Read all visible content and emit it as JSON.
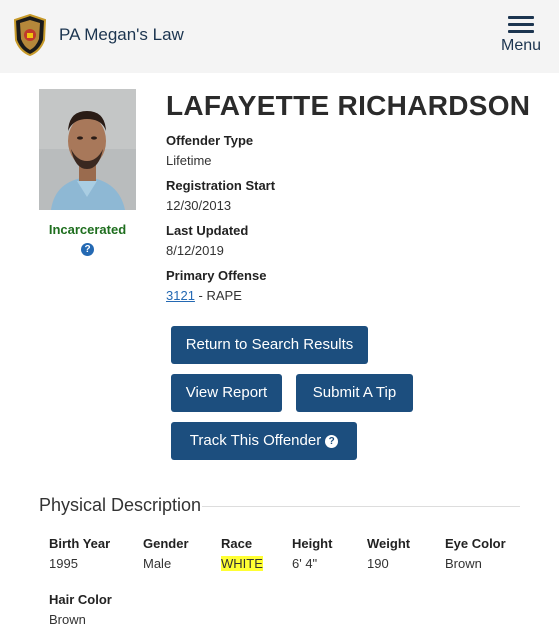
{
  "header": {
    "site_title": "PA Megan's Law",
    "menu_label": "Menu"
  },
  "offender": {
    "name": "LAFAYETTE RICHARDSON",
    "status": "Incarcerated",
    "fields": {
      "offender_type_label": "Offender Type",
      "offender_type": "Lifetime",
      "registration_start_label": "Registration Start",
      "registration_start": "12/30/2013",
      "last_updated_label": "Last Updated",
      "last_updated": "8/12/2019",
      "primary_offense_label": "Primary Offense",
      "primary_offense_code": "3121",
      "primary_offense_desc": " - RAPE"
    }
  },
  "actions": {
    "return": "Return to Search Results",
    "view_report": "View Report",
    "submit_tip": "Submit A Tip",
    "track": "Track This Offender"
  },
  "physical": {
    "title": "Physical Description",
    "birth_year_label": "Birth Year",
    "birth_year": "1995",
    "gender_label": "Gender",
    "gender": "Male",
    "race_label": "Race",
    "race": "WHITE",
    "height_label": "Height",
    "height": "6' 4\"",
    "weight_label": "Weight",
    "weight": "190",
    "eye_color_label": "Eye Color",
    "eye_color": "Brown",
    "hair_color_label": "Hair Color",
    "hair_color": "Brown"
  },
  "colors": {
    "primary_button": "#1c4e7e",
    "status_green": "#1e6e1e",
    "highlight": "#ffff33"
  }
}
